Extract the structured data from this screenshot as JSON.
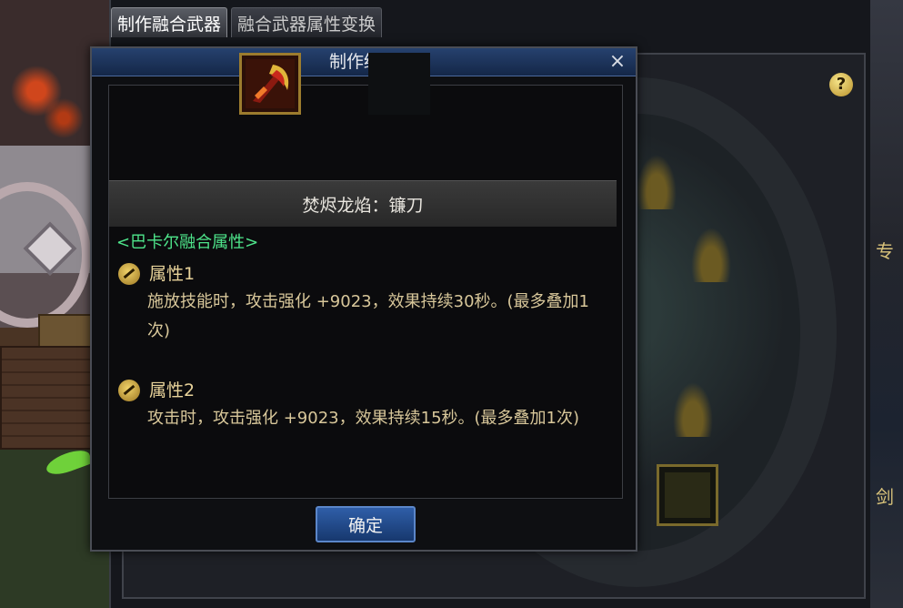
{
  "window": {
    "tabs": [
      {
        "label": "制作融合武器",
        "active": true
      },
      {
        "label": "融合武器属性变换",
        "active": false
      }
    ],
    "help_label": "?"
  },
  "dialog": {
    "title": "制作结果",
    "close_label": "×",
    "item_icon": "scythe-weapon-icon",
    "item_name": "焚烬龙焰：镰刀",
    "fusion_title": "<巴卡尔融合属性>",
    "attributes": [
      {
        "name": "属性1",
        "description": "施放技能时，攻击强化 +9023，效果持续30秒。(最多叠加1次)"
      },
      {
        "name": "属性2",
        "description": "攻击时，攻击强化 +9023，效果持续15秒。(最多叠加1次)"
      }
    ],
    "confirm_label": "确定"
  },
  "side_glyphs": [
    "专",
    "剑"
  ],
  "colors": {
    "title_bar": "#1e3560",
    "fusion_text": "#4ee48a",
    "attribute_text": "#d8c79a",
    "button": "#2a5296"
  }
}
